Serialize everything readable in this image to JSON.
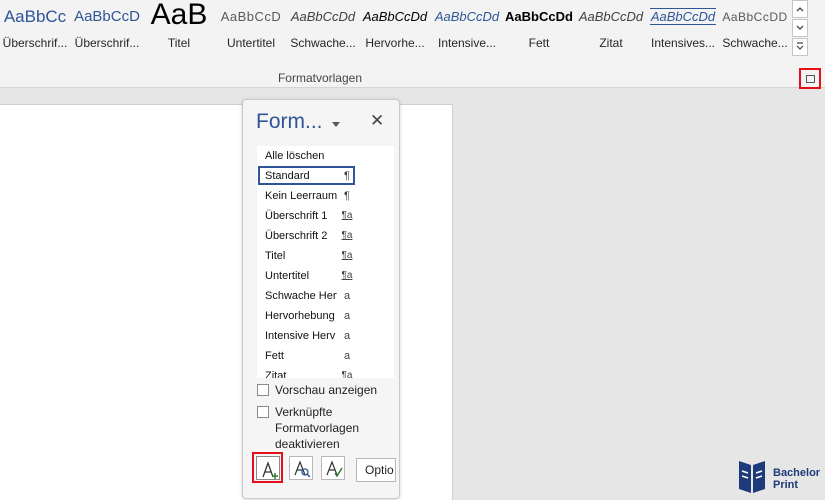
{
  "ribbon": {
    "group_label": "Formatvorlagen",
    "styles": [
      {
        "preview": "AaBbCc",
        "name": "Überschrif..."
      },
      {
        "preview": "AaBbCcD",
        "name": "Überschrif..."
      },
      {
        "preview": "AaB",
        "name": "Titel"
      },
      {
        "preview": "AaBbCcD",
        "name": "Untertitel"
      },
      {
        "preview": "AaBbCcDd",
        "name": "Schwache..."
      },
      {
        "preview": "AaBbCcDd",
        "name": "Hervorhe..."
      },
      {
        "preview": "AaBbCcDd",
        "name": "Intensive..."
      },
      {
        "preview": "AaBbCcDd",
        "name": "Fett"
      },
      {
        "preview": "AaBbCcDd",
        "name": "Zitat"
      },
      {
        "preview": "AaBbCcDd",
        "name": "Intensives..."
      },
      {
        "preview": "AaBbCcDD",
        "name": "Schwache..."
      }
    ]
  },
  "pane": {
    "title": "Form...",
    "items": [
      {
        "label": "Alle löschen",
        "icon": ""
      },
      {
        "label": "Standard",
        "icon": "¶"
      },
      {
        "label": "Kein Leerraum",
        "icon": "¶"
      },
      {
        "label": "Überschrift 1",
        "icon": "¶a"
      },
      {
        "label": "Überschrift 2",
        "icon": "¶a"
      },
      {
        "label": "Titel",
        "icon": "¶a"
      },
      {
        "label": "Untertitel",
        "icon": "¶a"
      },
      {
        "label": "Schwache Herv",
        "icon": "a"
      },
      {
        "label": "Hervorhebung",
        "icon": "a"
      },
      {
        "label": "Intensive Herv",
        "icon": "a"
      },
      {
        "label": "Fett",
        "icon": "a"
      },
      {
        "label": "Zitat",
        "icon": "¶a"
      }
    ],
    "selected_index": 1,
    "preview_label": "Vorschau anzeigen",
    "linked_label_1": "Verknüpfte",
    "linked_label_2": "Formatvorlagen",
    "linked_label_3": "deaktivieren",
    "options_label": "Optio"
  },
  "logo": {
    "line1": "Bachelor",
    "line2": "Print"
  },
  "colors": {
    "accent": "#2f5597",
    "highlight": "#e3101a"
  }
}
